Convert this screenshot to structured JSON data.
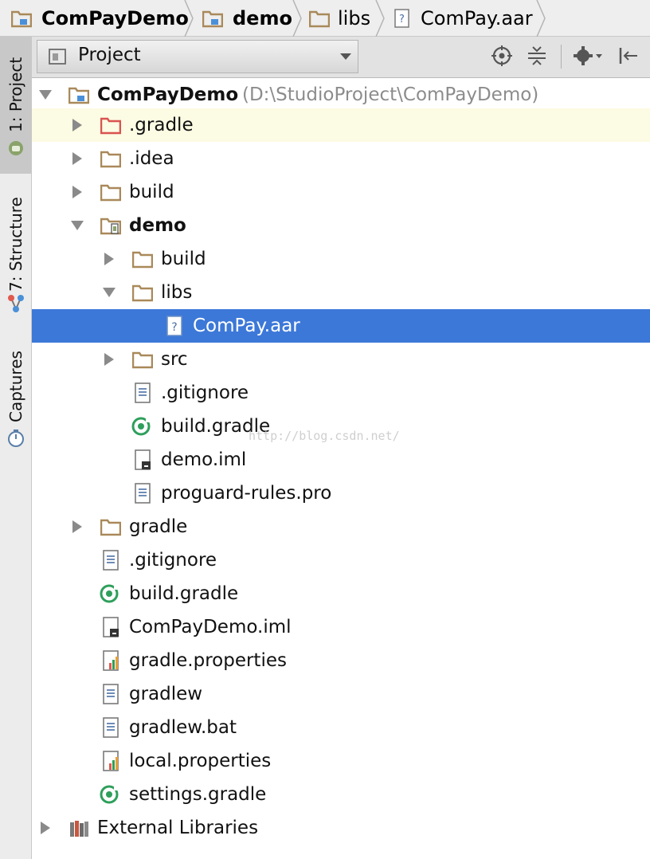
{
  "breadcrumb": {
    "items": [
      {
        "label": "ComPayDemo",
        "icon": "module-folder-icon"
      },
      {
        "label": "demo",
        "icon": "module-folder-icon"
      },
      {
        "label": "libs",
        "icon": "folder-icon"
      },
      {
        "label": "ComPay.aar",
        "icon": "unknown-file-icon"
      }
    ]
  },
  "toolstrip": {
    "tabs": [
      {
        "label": "1: Project",
        "icon": "android-icon"
      },
      {
        "label": "7: Structure",
        "icon": "structure-icon"
      },
      {
        "label": "Captures",
        "icon": "captures-icon"
      }
    ]
  },
  "panel": {
    "view_mode": "Project",
    "toolbar_icons": [
      "locate-icon",
      "collapse-all-icon",
      "settings-gear-icon",
      "hide-panel-icon"
    ]
  },
  "tree": {
    "root_name": "ComPayDemo",
    "root_path": "(D:\\StudioProject\\ComPayDemo)",
    "nodes": [
      {
        "label": ".gradle",
        "icon": "excluded-folder-icon",
        "expanded": false
      },
      {
        "label": ".idea",
        "icon": "folder-icon",
        "expanded": false
      },
      {
        "label": "build",
        "icon": "folder-icon",
        "expanded": false
      },
      {
        "label": "demo",
        "icon": "android-module-folder-icon",
        "expanded": true
      },
      {
        "label": "build",
        "icon": "folder-icon",
        "expanded": false
      },
      {
        "label": "libs",
        "icon": "folder-icon",
        "expanded": true
      },
      {
        "label": "ComPay.aar",
        "icon": "unknown-file-icon",
        "selected": true
      },
      {
        "label": "src",
        "icon": "folder-icon",
        "expanded": false
      },
      {
        "label": ".gitignore",
        "icon": "text-file-icon"
      },
      {
        "label": "build.gradle",
        "icon": "gradle-file-icon"
      },
      {
        "label": "demo.iml",
        "icon": "iml-file-icon"
      },
      {
        "label": "proguard-rules.pro",
        "icon": "text-file-icon"
      },
      {
        "label": "gradle",
        "icon": "folder-icon",
        "expanded": false
      },
      {
        "label": ".gitignore",
        "icon": "text-file-icon"
      },
      {
        "label": "build.gradle",
        "icon": "gradle-file-icon"
      },
      {
        "label": "ComPayDemo.iml",
        "icon": "iml-file-icon"
      },
      {
        "label": "gradle.properties",
        "icon": "properties-file-icon"
      },
      {
        "label": "gradlew",
        "icon": "text-file-icon"
      },
      {
        "label": "gradlew.bat",
        "icon": "text-file-icon"
      },
      {
        "label": "local.properties",
        "icon": "properties-file-icon"
      },
      {
        "label": "settings.gradle",
        "icon": "gradle-file-icon"
      },
      {
        "label": "External Libraries",
        "icon": "external-libraries-icon",
        "expanded": false
      }
    ]
  },
  "watermark": "http://blog.csdn.net/",
  "colors": {
    "selection": "#3c78d8",
    "highlight_row": "#fcfbe3",
    "folder": "#a9895a",
    "gradle_green": "#2e9f5b"
  }
}
